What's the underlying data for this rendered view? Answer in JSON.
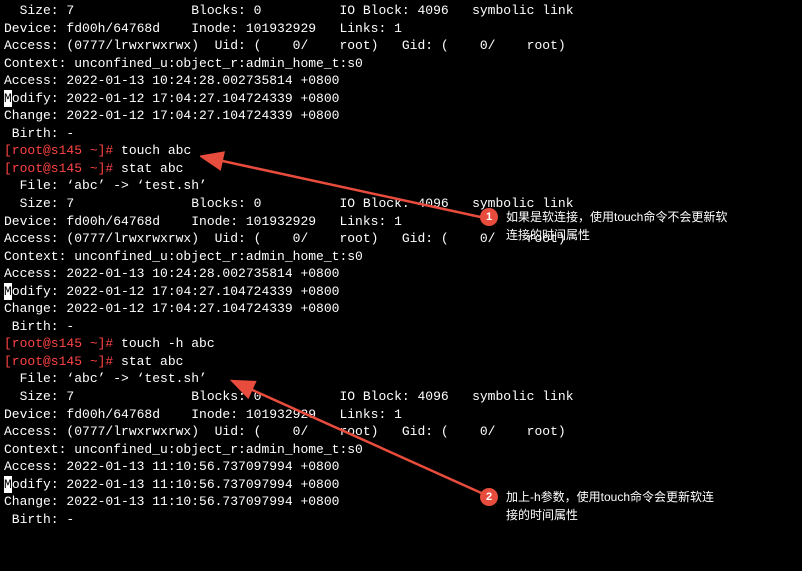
{
  "block1": {
    "size": "  Size: 7               Blocks: 0          IO Block: 4096   symbolic link",
    "device": "Device: fd00h/64768d    Inode: 101932929   Links: 1",
    "access_perm": "Access: (0777/lrwxrwxrwx)  Uid: (    0/    root)   Gid: (    0/    root)",
    "context": "Context: unconfined_u:object_r:admin_home_t:s0",
    "access_time": "Access: 2022-01-13 10:24:28.002735814 +0800",
    "modify_time": "odify: 2022-01-12 17:04:27.104724339 +0800",
    "change_time": "Change: 2022-01-12 17:04:27.104724339 +0800",
    "birth": " Birth: -"
  },
  "cmd1": {
    "prompt": "[root@s145 ~]# ",
    "command": "touch abc"
  },
  "cmd2": {
    "prompt": "[root@s145 ~]# ",
    "command": "stat abc"
  },
  "block2": {
    "file": "  File: ‘abc’ -> ‘test.sh’",
    "size": "  Size: 7               Blocks: 0          IO Block: 4096   symbolic link",
    "device": "Device: fd00h/64768d    Inode: 101932929   Links: 1",
    "access_perm": "Access: (0777/lrwxrwxrwx)  Uid: (    0/    root)   Gid: (    0/    root)",
    "context": "Context: unconfined_u:object_r:admin_home_t:s0",
    "access_time": "Access: 2022-01-13 10:24:28.002735814 +0800",
    "modify_time": "odify: 2022-01-12 17:04:27.104724339 +0800",
    "change_time": "Change: 2022-01-12 17:04:27.104724339 +0800",
    "birth": " Birth: -"
  },
  "cmd3": {
    "prompt": "[root@s145 ~]# ",
    "command": "touch -h abc"
  },
  "cmd4": {
    "prompt": "[root@s145 ~]# ",
    "command": "stat abc"
  },
  "block3": {
    "file": "  File: ‘abc’ -> ‘test.sh’",
    "size": "  Size: 7               Blocks: 0          IO Block: 4096   symbolic link",
    "device": "Device: fd00h/64768d    Inode: 101932929   Links: 1",
    "access_perm": "Access: (0777/lrwxrwxrwx)  Uid: (    0/    root)   Gid: (    0/    root)",
    "context": "Context: unconfined_u:object_r:admin_home_t:s0",
    "access_time": "Access: 2022-01-13 11:10:56.737097994 +0800",
    "modify_time": "odify: 2022-01-13 11:10:56.737097994 +0800",
    "change_time": "Change: 2022-01-13 11:10:56.737097994 +0800",
    "birth": " Birth: -"
  },
  "annotations": {
    "num1": "1",
    "text1a": "如果是软连接，使用touch命令不会更新软",
    "text1b": "连接的时间属性",
    "num2": "2",
    "text2a": "加上-h参数，使用touch命令会更新软连",
    "text2b": "接的时间属性"
  }
}
